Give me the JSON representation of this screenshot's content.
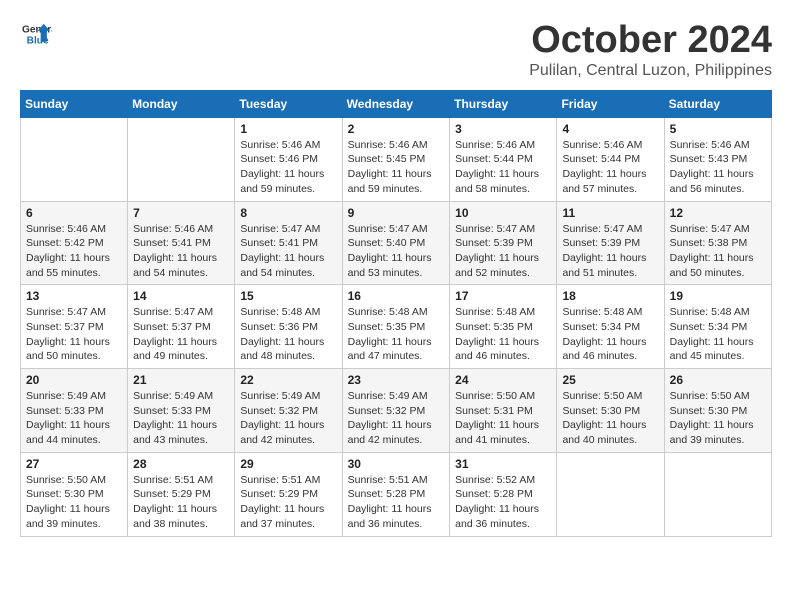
{
  "header": {
    "logo_line1": "General",
    "logo_line2": "Blue",
    "month": "October 2024",
    "location": "Pulilan, Central Luzon, Philippines"
  },
  "weekdays": [
    "Sunday",
    "Monday",
    "Tuesday",
    "Wednesday",
    "Thursday",
    "Friday",
    "Saturday"
  ],
  "weeks": [
    [
      {
        "day": "",
        "info": ""
      },
      {
        "day": "",
        "info": ""
      },
      {
        "day": "1",
        "info": "Sunrise: 5:46 AM\nSunset: 5:46 PM\nDaylight: 11 hours and 59 minutes."
      },
      {
        "day": "2",
        "info": "Sunrise: 5:46 AM\nSunset: 5:45 PM\nDaylight: 11 hours and 59 minutes."
      },
      {
        "day": "3",
        "info": "Sunrise: 5:46 AM\nSunset: 5:44 PM\nDaylight: 11 hours and 58 minutes."
      },
      {
        "day": "4",
        "info": "Sunrise: 5:46 AM\nSunset: 5:44 PM\nDaylight: 11 hours and 57 minutes."
      },
      {
        "day": "5",
        "info": "Sunrise: 5:46 AM\nSunset: 5:43 PM\nDaylight: 11 hours and 56 minutes."
      }
    ],
    [
      {
        "day": "6",
        "info": "Sunrise: 5:46 AM\nSunset: 5:42 PM\nDaylight: 11 hours and 55 minutes."
      },
      {
        "day": "7",
        "info": "Sunrise: 5:46 AM\nSunset: 5:41 PM\nDaylight: 11 hours and 54 minutes."
      },
      {
        "day": "8",
        "info": "Sunrise: 5:47 AM\nSunset: 5:41 PM\nDaylight: 11 hours and 54 minutes."
      },
      {
        "day": "9",
        "info": "Sunrise: 5:47 AM\nSunset: 5:40 PM\nDaylight: 11 hours and 53 minutes."
      },
      {
        "day": "10",
        "info": "Sunrise: 5:47 AM\nSunset: 5:39 PM\nDaylight: 11 hours and 52 minutes."
      },
      {
        "day": "11",
        "info": "Sunrise: 5:47 AM\nSunset: 5:39 PM\nDaylight: 11 hours and 51 minutes."
      },
      {
        "day": "12",
        "info": "Sunrise: 5:47 AM\nSunset: 5:38 PM\nDaylight: 11 hours and 50 minutes."
      }
    ],
    [
      {
        "day": "13",
        "info": "Sunrise: 5:47 AM\nSunset: 5:37 PM\nDaylight: 11 hours and 50 minutes."
      },
      {
        "day": "14",
        "info": "Sunrise: 5:47 AM\nSunset: 5:37 PM\nDaylight: 11 hours and 49 minutes."
      },
      {
        "day": "15",
        "info": "Sunrise: 5:48 AM\nSunset: 5:36 PM\nDaylight: 11 hours and 48 minutes."
      },
      {
        "day": "16",
        "info": "Sunrise: 5:48 AM\nSunset: 5:35 PM\nDaylight: 11 hours and 47 minutes."
      },
      {
        "day": "17",
        "info": "Sunrise: 5:48 AM\nSunset: 5:35 PM\nDaylight: 11 hours and 46 minutes."
      },
      {
        "day": "18",
        "info": "Sunrise: 5:48 AM\nSunset: 5:34 PM\nDaylight: 11 hours and 46 minutes."
      },
      {
        "day": "19",
        "info": "Sunrise: 5:48 AM\nSunset: 5:34 PM\nDaylight: 11 hours and 45 minutes."
      }
    ],
    [
      {
        "day": "20",
        "info": "Sunrise: 5:49 AM\nSunset: 5:33 PM\nDaylight: 11 hours and 44 minutes."
      },
      {
        "day": "21",
        "info": "Sunrise: 5:49 AM\nSunset: 5:33 PM\nDaylight: 11 hours and 43 minutes."
      },
      {
        "day": "22",
        "info": "Sunrise: 5:49 AM\nSunset: 5:32 PM\nDaylight: 11 hours and 42 minutes."
      },
      {
        "day": "23",
        "info": "Sunrise: 5:49 AM\nSunset: 5:32 PM\nDaylight: 11 hours and 42 minutes."
      },
      {
        "day": "24",
        "info": "Sunrise: 5:50 AM\nSunset: 5:31 PM\nDaylight: 11 hours and 41 minutes."
      },
      {
        "day": "25",
        "info": "Sunrise: 5:50 AM\nSunset: 5:30 PM\nDaylight: 11 hours and 40 minutes."
      },
      {
        "day": "26",
        "info": "Sunrise: 5:50 AM\nSunset: 5:30 PM\nDaylight: 11 hours and 39 minutes."
      }
    ],
    [
      {
        "day": "27",
        "info": "Sunrise: 5:50 AM\nSunset: 5:30 PM\nDaylight: 11 hours and 39 minutes."
      },
      {
        "day": "28",
        "info": "Sunrise: 5:51 AM\nSunset: 5:29 PM\nDaylight: 11 hours and 38 minutes."
      },
      {
        "day": "29",
        "info": "Sunrise: 5:51 AM\nSunset: 5:29 PM\nDaylight: 11 hours and 37 minutes."
      },
      {
        "day": "30",
        "info": "Sunrise: 5:51 AM\nSunset: 5:28 PM\nDaylight: 11 hours and 36 minutes."
      },
      {
        "day": "31",
        "info": "Sunrise: 5:52 AM\nSunset: 5:28 PM\nDaylight: 11 hours and 36 minutes."
      },
      {
        "day": "",
        "info": ""
      },
      {
        "day": "",
        "info": ""
      }
    ]
  ]
}
